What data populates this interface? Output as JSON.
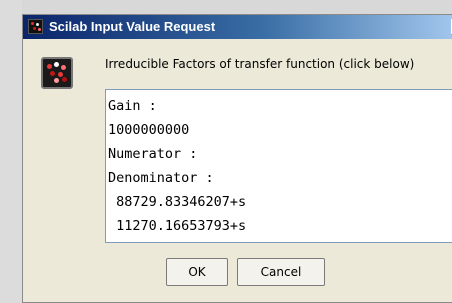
{
  "window": {
    "title": "Scilab Input Value Request",
    "close_glyph": "x"
  },
  "dialog": {
    "prompt": "Irreducible Factors of transfer function (click below)",
    "lines": [
      "Gain :",
      "1000000000",
      "Numerator :",
      "Denominator :",
      " 88729.83346207+s",
      " 11270.16653793+s"
    ]
  },
  "buttons": {
    "ok_label": "OK",
    "cancel_label": "Cancel"
  },
  "colors": {
    "titlebar_start": "#0a246a",
    "titlebar_end": "#a6caf0",
    "dialog_bg": "#ece9d8"
  },
  "icons": {
    "title": "scilab-icon",
    "logo": "scilab-logo-icon",
    "close": "close-icon"
  }
}
